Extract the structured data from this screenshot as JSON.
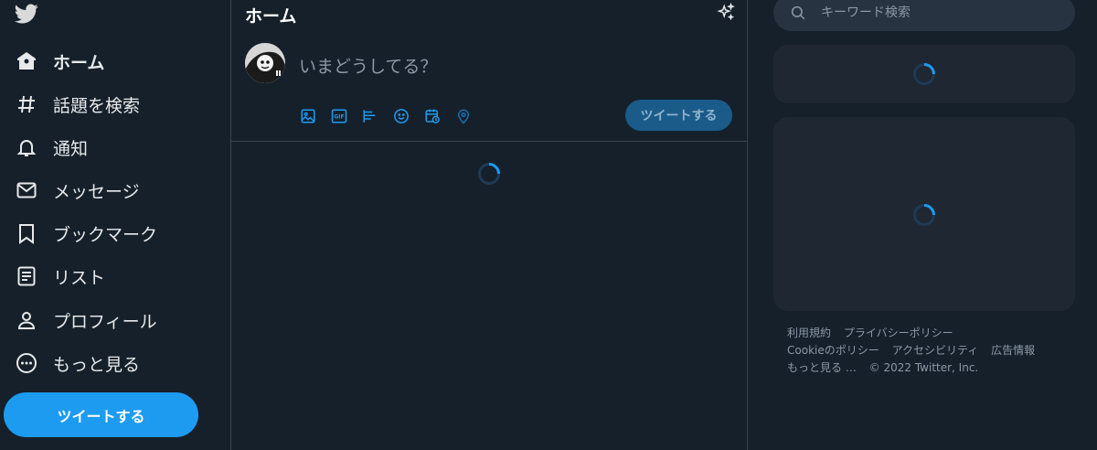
{
  "sidebar": {
    "items": [
      {
        "label": "ホーム",
        "icon": "home-icon"
      },
      {
        "label": "話題を検索",
        "icon": "hashtag-icon"
      },
      {
        "label": "通知",
        "icon": "bell-icon"
      },
      {
        "label": "メッセージ",
        "icon": "envelope-icon"
      },
      {
        "label": "ブックマーク",
        "icon": "bookmark-icon"
      },
      {
        "label": "リスト",
        "icon": "list-icon"
      },
      {
        "label": "プロフィール",
        "icon": "user-icon"
      },
      {
        "label": "もっと見る",
        "icon": "more-circle-icon"
      }
    ],
    "tweet_button": "ツイートする"
  },
  "main": {
    "title": "ホーム",
    "compose": {
      "placeholder": "いまどうしてる？",
      "tools": [
        "image-icon",
        "gif-icon",
        "poll-icon",
        "emoji-icon",
        "schedule-icon",
        "location-icon"
      ],
      "submit": "ツイートする"
    }
  },
  "right": {
    "search_placeholder": "キーワード検索",
    "footer": {
      "links": [
        "利用規約",
        "プライバシーポリシー",
        "Cookieのポリシー",
        "アクセシビリティ",
        "広告情報",
        "もっと見る …"
      ],
      "copyright": "© 2022 Twitter, Inc."
    }
  },
  "colors": {
    "background": "#15202b",
    "accent": "#1d9bf0",
    "panel": "#1e2732",
    "border": "#38444d",
    "muted_text": "#8b98a5"
  }
}
